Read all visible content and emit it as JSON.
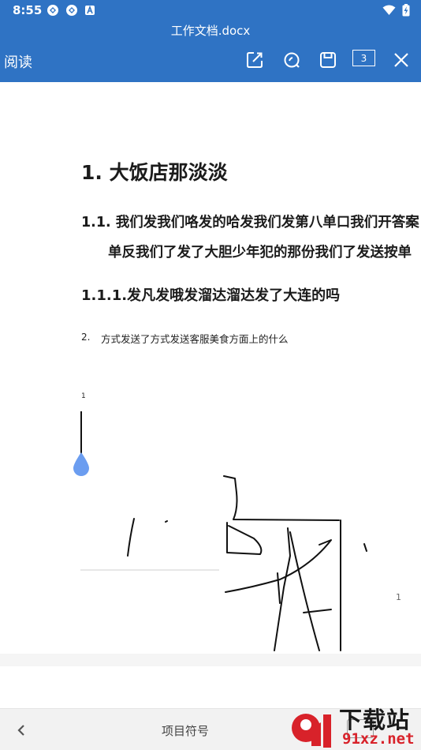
{
  "status_bar": {
    "time": "8:55",
    "notification_icons": [
      "sync-icon",
      "sync-icon",
      "font-app-icon"
    ],
    "system_icons": [
      "wifi-icon",
      "battery-charging-icon"
    ]
  },
  "title_bar": {
    "file_name": "工作文档.docx"
  },
  "toolbar": {
    "mode_label": "阅读",
    "page_count": "3",
    "buttons": [
      "edit-icon",
      "search-icon",
      "save-icon",
      "close-icon"
    ]
  },
  "document": {
    "heading1": "1. 大饭店那淡淡",
    "heading2_line1": "1.1. 我们发我们咯发的哈发我们发第八单口我们开答案",
    "heading2_line2": "单反我们了发了大胆少年犯的那份我们了发送按单",
    "heading3": "1.1.1.发凡发哦发溜达溜达发了大连的吗",
    "list_number": "2.",
    "list_text": "方式发送了方式发送客服美食方面上的什么",
    "cursor_label": "1",
    "page_number": "1"
  },
  "bottom_bar": {
    "label": "项目符号"
  },
  "watermark": {
    "text_top": "下载站",
    "text_bottom": "91xz.net",
    "logo_text": "9"
  },
  "colors": {
    "header": "#2f73c4",
    "drop": "#6b9df0",
    "watermark_red": "#d8222a"
  }
}
